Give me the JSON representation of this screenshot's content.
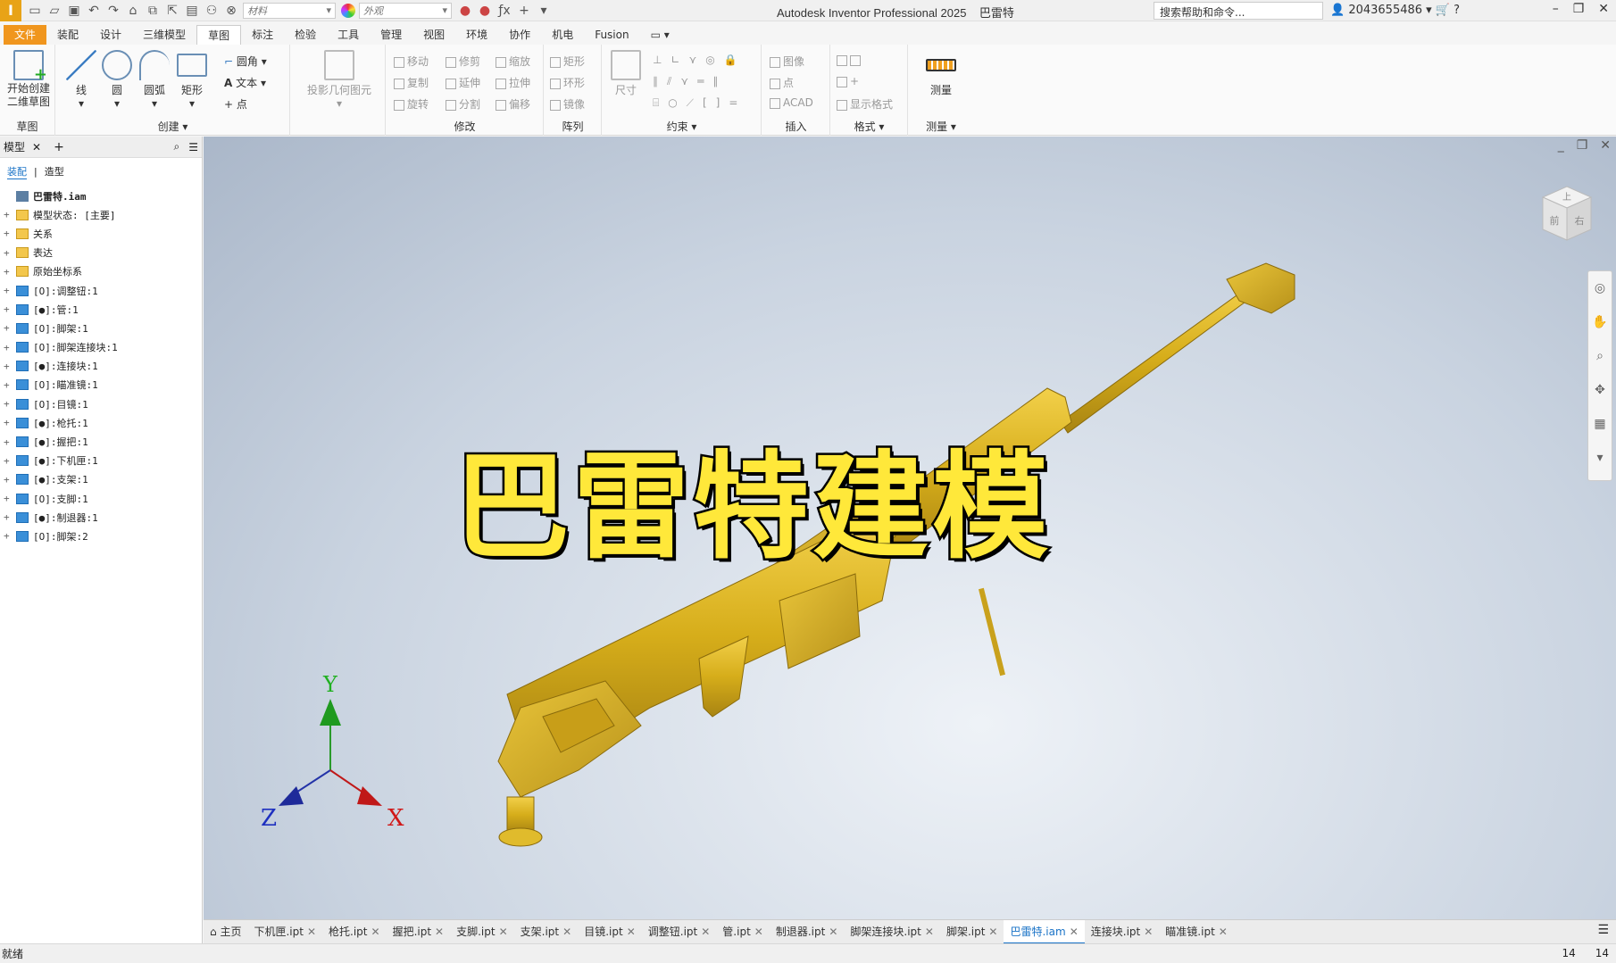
{
  "titlebar": {
    "logo": "I",
    "material_placeholder": "材料",
    "appearance_placeholder": "外观",
    "app_title": "Autodesk Inventor Professional 2025",
    "doc_title": "巴雷特",
    "help_search": "搜索帮助和命令...",
    "user_id": "2043655486"
  },
  "menu_tabs": [
    "文件",
    "装配",
    "设计",
    "三维模型",
    "草图",
    "标注",
    "检验",
    "工具",
    "管理",
    "视图",
    "环境",
    "协作",
    "机电",
    "Fusion"
  ],
  "ribbon": {
    "sketch": {
      "start_label": "开始创建\n二维草图",
      "group": "草图"
    },
    "create": {
      "line": "线",
      "circle": "圆",
      "arc": "圆弧",
      "rect": "矩形",
      "fillet": "圆角",
      "text": "文本",
      "point": "点",
      "group": "创建"
    },
    "project": {
      "label": "投影几何图元"
    },
    "modify": {
      "move": "移动",
      "trim": "修剪",
      "scale": "缩放",
      "copy": "复制",
      "extend": "延伸",
      "stretch": "拉伸",
      "rotate": "旋转",
      "split": "分割",
      "offset": "偏移",
      "group": "修改"
    },
    "pattern": {
      "rect": "矩形",
      "circ": "环形",
      "mirror": "镜像",
      "group": "阵列"
    },
    "constrain": {
      "dim": "尺寸",
      "group": "约束"
    },
    "insert": {
      "image": "图像",
      "point": "点",
      "acad": "ACAD",
      "group": "插入"
    },
    "format": {
      "show": "显示格式",
      "group": "格式"
    },
    "measure": {
      "label": "测量",
      "group": "测量"
    }
  },
  "left_panel": {
    "tab_label": "模型",
    "sub_tabs": [
      "装配",
      "造型"
    ],
    "tree": [
      {
        "label": "巴雷特.iam",
        "type": "asm",
        "pm": ""
      },
      {
        "label": "模型状态: [主要]",
        "type": "folder",
        "pm": "+"
      },
      {
        "label": "关系",
        "type": "folder",
        "pm": "+"
      },
      {
        "label": "表达",
        "type": "folder",
        "pm": "+"
      },
      {
        "label": "原始坐标系",
        "type": "folder",
        "pm": "+"
      },
      {
        "label": "[O]:调整钮:1",
        "type": "part",
        "pm": "+"
      },
      {
        "label": "[●]:管:1",
        "type": "part",
        "pm": "+"
      },
      {
        "label": "[O]:脚架:1",
        "type": "part",
        "pm": "+"
      },
      {
        "label": "[O]:脚架连接块:1",
        "type": "part",
        "pm": "+"
      },
      {
        "label": "[●]:连接块:1",
        "type": "part",
        "pm": "+"
      },
      {
        "label": "[O]:瞄准镜:1",
        "type": "part",
        "pm": "+"
      },
      {
        "label": "[O]:目镜:1",
        "type": "part",
        "pm": "+"
      },
      {
        "label": "[●]:枪托:1",
        "type": "part",
        "pm": "+"
      },
      {
        "label": "[●]:握把:1",
        "type": "part",
        "pm": "+"
      },
      {
        "label": "[●]:下机匣:1",
        "type": "part",
        "pm": "+"
      },
      {
        "label": "[●]:支架:1",
        "type": "part",
        "pm": "+"
      },
      {
        "label": "[O]:支脚:1",
        "type": "part",
        "pm": "+"
      },
      {
        "label": "[●]:制退器:1",
        "type": "part",
        "pm": "+"
      },
      {
        "label": "[O]:脚架:2",
        "type": "part",
        "pm": "+"
      }
    ]
  },
  "viewport": {
    "overlay_title": "巴雷特建模",
    "axis_x": "X",
    "axis_y": "Y",
    "axis_z": "Z",
    "viewcube_top": "上",
    "viewcube_front": "前",
    "viewcube_right": "右"
  },
  "doc_tabs": [
    {
      "label": "主页",
      "close": false,
      "active": false
    },
    {
      "label": "下机匣.ipt",
      "close": true,
      "active": false
    },
    {
      "label": "枪托.ipt",
      "close": true,
      "active": false
    },
    {
      "label": "握把.ipt",
      "close": true,
      "active": false
    },
    {
      "label": "支脚.ipt",
      "close": true,
      "active": false
    },
    {
      "label": "支架.ipt",
      "close": true,
      "active": false
    },
    {
      "label": "目镜.ipt",
      "close": true,
      "active": false
    },
    {
      "label": "调整钮.ipt",
      "close": true,
      "active": false
    },
    {
      "label": "管.ipt",
      "close": true,
      "active": false
    },
    {
      "label": "制退器.ipt",
      "close": true,
      "active": false
    },
    {
      "label": "脚架连接块.ipt",
      "close": true,
      "active": false
    },
    {
      "label": "脚架.ipt",
      "close": true,
      "active": false
    },
    {
      "label": "巴雷特.iam",
      "close": true,
      "active": true
    },
    {
      "label": "连接块.ipt",
      "close": true,
      "active": false
    },
    {
      "label": "瞄准镜.ipt",
      "close": true,
      "active": false
    }
  ],
  "status": {
    "text": "就绪",
    "count1": "14",
    "count2": "14"
  },
  "colors": {
    "accent": "#f0961e",
    "model_gold": "#d9b21e",
    "active_tab": "#1a73c7"
  }
}
